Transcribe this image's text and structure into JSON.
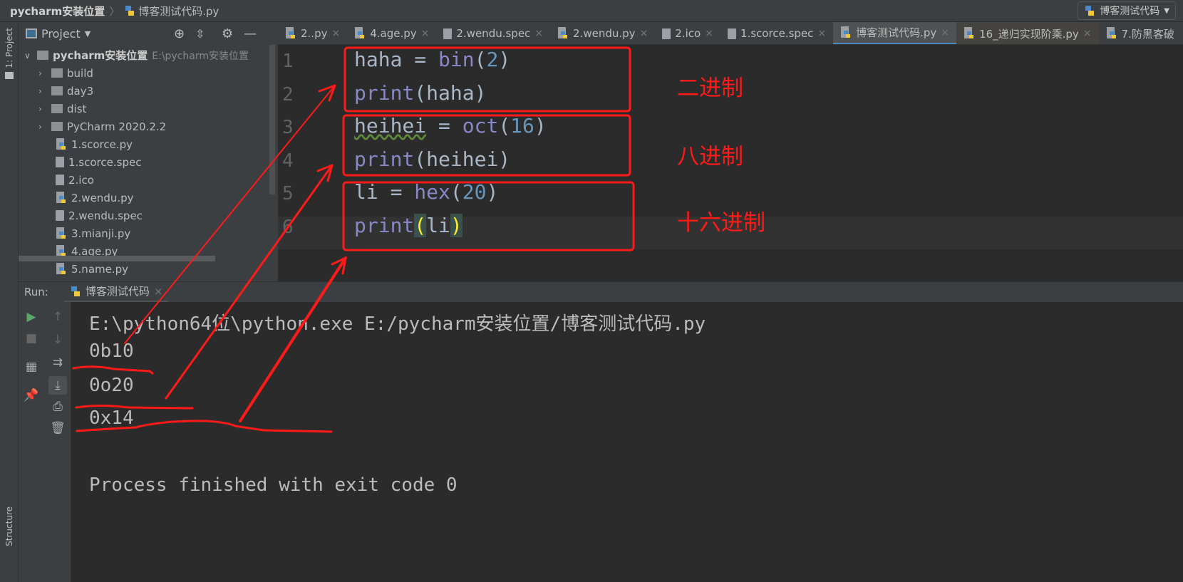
{
  "titlebar": {
    "project": "pycharm安装位置",
    "file": "博客测试代码.py",
    "run_config": "博客测试代码"
  },
  "stripe": {
    "project_label": "1: Project",
    "structure_label": "Structure"
  },
  "project_panel": {
    "title": "Project",
    "root": {
      "name": "pycharm安装位置",
      "path": "E:\\pycharm安装位置"
    },
    "items": [
      {
        "name": "build",
        "type": "folder"
      },
      {
        "name": "day3",
        "type": "folder"
      },
      {
        "name": "dist",
        "type": "folder"
      },
      {
        "name": "PyCharm 2020.2.2",
        "type": "folder"
      },
      {
        "name": "1.scorce.py",
        "type": "py"
      },
      {
        "name": "1.scorce.spec",
        "type": "file"
      },
      {
        "name": "2.ico",
        "type": "file"
      },
      {
        "name": "2.wendu.py",
        "type": "py"
      },
      {
        "name": "2.wendu.spec",
        "type": "file"
      },
      {
        "name": "3.mianji.py",
        "type": "py"
      },
      {
        "name": "4.age.py",
        "type": "py"
      },
      {
        "name": "5.name.py",
        "type": "py"
      }
    ]
  },
  "tabs": [
    {
      "label": "2..py",
      "type": "py"
    },
    {
      "label": "4.age.py",
      "type": "py"
    },
    {
      "label": "2.wendu.spec",
      "type": "file"
    },
    {
      "label": "2.wendu.py",
      "type": "py"
    },
    {
      "label": "2.ico",
      "type": "file"
    },
    {
      "label": "1.scorce.spec",
      "type": "file"
    },
    {
      "label": "博客测试代码.py",
      "type": "py",
      "active": true
    },
    {
      "label": "16_递归实现阶乘.py",
      "type": "py"
    },
    {
      "label": "7.防黑客破",
      "type": "py"
    }
  ],
  "editor": {
    "line_numbers": [
      "1",
      "2",
      "3",
      "4",
      "5",
      "6"
    ],
    "lines": [
      [
        {
          "t": "haha = "
        },
        {
          "t": "bin",
          "c": "fn"
        },
        {
          "t": "("
        },
        {
          "t": "2",
          "c": "num"
        },
        {
          "t": ")"
        }
      ],
      [
        {
          "t": "print",
          "c": "fn"
        },
        {
          "t": "(haha)"
        }
      ],
      [
        {
          "t": "heihei",
          "c": "wavy"
        },
        {
          "t": " = "
        },
        {
          "t": "oct",
          "c": "fn"
        },
        {
          "t": "("
        },
        {
          "t": "16",
          "c": "num"
        },
        {
          "t": ")"
        }
      ],
      [
        {
          "t": "print",
          "c": "fn"
        },
        {
          "t": "(heihei)"
        }
      ],
      [
        {
          "t": "li = "
        },
        {
          "t": "hex",
          "c": "fn"
        },
        {
          "t": "("
        },
        {
          "t": "20",
          "c": "num"
        },
        {
          "t": ")"
        }
      ],
      [
        {
          "t": "print",
          "c": "fn"
        },
        {
          "t": "(",
          "c": "br"
        },
        {
          "t": "li"
        },
        {
          "t": ")",
          "c": "br"
        }
      ]
    ]
  },
  "annotations": {
    "binary": "二进制",
    "octal": "八进制",
    "hex": "十六进制",
    "color": "#ff1a1a"
  },
  "run": {
    "label": "Run:",
    "tab": "博客测试代码",
    "output": [
      "E:\\python64位\\python.exe E:/pycharm安装位置/博客测试代码.py",
      "0b10",
      "0o20",
      "0x14",
      "",
      "Process finished with exit code 0"
    ]
  }
}
